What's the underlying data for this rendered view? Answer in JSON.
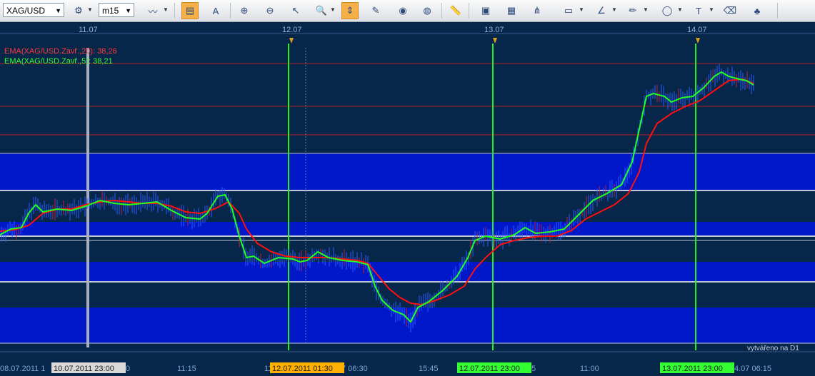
{
  "toolbar": {
    "symbol": "XAG/USD",
    "timeframe": "m15",
    "icons": [
      "indicator-settings-icon",
      "timeframe-icon",
      "chart-type-icon",
      "bar-chart-icon",
      "text-format-icon",
      "zoom-in-icon",
      "zoom-out-icon",
      "cursor-icon",
      "zoom-area-icon",
      "fit-icon",
      "edit-icon",
      "eye-icon",
      "globe-icon",
      "ruler-icon",
      "image-icon",
      "chart-icon",
      "fork-icon",
      "channel-icon",
      "fibonacci-icon",
      "pencil-icon",
      "ellipse-icon",
      "text-icon",
      "eraser-icon",
      "tree-icon"
    ]
  },
  "chart": {
    "top_dates": [
      "11.07",
      "12.07",
      "13.07",
      "14.07"
    ],
    "ema20_label": "EMA(XAG/USD.Zavř.,20): 38,26",
    "ema5_label": "EMA(XAG/USD.Zavř.,5): 38,21",
    "watermark": "vytvářeno na D1",
    "bottom_labels": [
      "08.07.2011 1",
      "0",
      "11:15",
      "11.0",
      "7 06:30",
      "15:45",
      "5",
      "11:00",
      "4.07 06:15"
    ],
    "highlight_labels": [
      {
        "text": "10.07.2011 23:00",
        "color": "#d9d9d9"
      },
      {
        "text": "12.07.2011 01:30",
        "color": "#ffb000"
      },
      {
        "text": "12.07.2011 23:00",
        "color": "#33ff33"
      },
      {
        "text": "13.07.2011 23:00",
        "color": "#33ff33"
      }
    ],
    "colors": {
      "background": "#06264a",
      "band": "#0018c8",
      "ema20": "#ff1010",
      "ema5": "#22ff22",
      "day_line": "#22ee22",
      "cursor_line": "#a8b0c0",
      "candles": "#2a5cff"
    }
  }
}
